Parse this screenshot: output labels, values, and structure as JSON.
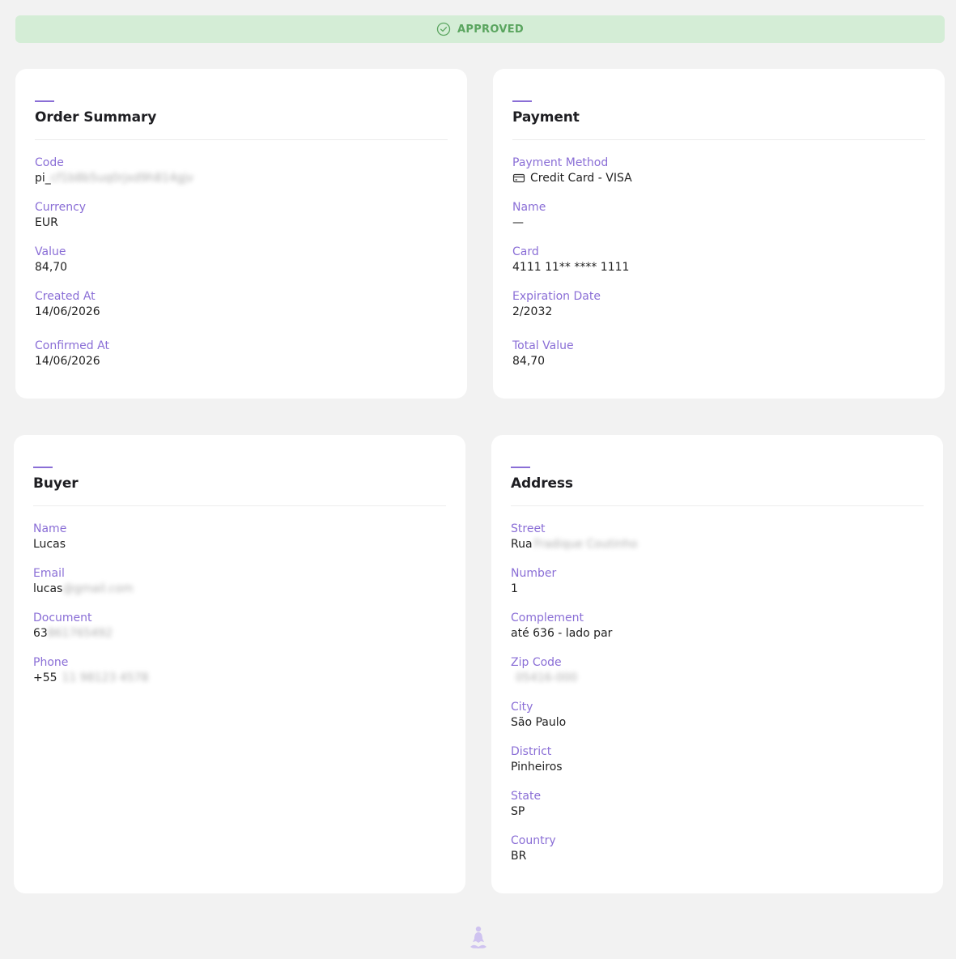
{
  "status": {
    "label": "APPROVED",
    "icon": "check-circle-icon",
    "color": "#5aa55f"
  },
  "order_summary": {
    "title": "Order Summary",
    "fields": [
      {
        "label": "Code",
        "value": "pi_",
        "redacted": "cf1b8b5uq0rjxd9h814gjv"
      },
      {
        "label": "Currency",
        "value": "EUR"
      },
      {
        "label": "Value",
        "value": "84,70"
      },
      {
        "label": "Created At",
        "value": "14/06/2026"
      },
      {
        "label": "Confirmed At",
        "value": "14/06/2026"
      }
    ]
  },
  "payment": {
    "title": "Payment",
    "fields": [
      {
        "label": "Payment Method",
        "value": "Credit Card - VISA",
        "icon": "credit-card-icon"
      },
      {
        "label": "Name",
        "value": "—"
      },
      {
        "label": "Card",
        "value": "4111 11** **** 1111"
      },
      {
        "label": "Expiration Date",
        "value": "2/2032"
      },
      {
        "label": "Total Value",
        "value": "84,70"
      }
    ]
  },
  "buyer": {
    "title": "Buyer",
    "fields": [
      {
        "label": "Name",
        "value": "Lucas"
      },
      {
        "label": "Email",
        "value": "lucas",
        "redacted": "@gmail.com"
      },
      {
        "label": "Document",
        "value": "63",
        "redacted": "861765492"
      },
      {
        "label": "Phone",
        "value": "+55",
        "redacted": "11 98123 4578"
      }
    ]
  },
  "address": {
    "title": "Address",
    "fields": [
      {
        "label": "Street",
        "value": "Rua",
        "redacted": "Fradique Coutinho"
      },
      {
        "label": "Number",
        "value": "1"
      },
      {
        "label": "Complement",
        "value": "até 636 - lado par"
      },
      {
        "label": "Zip Code",
        "value": "",
        "redacted": "05416-000"
      },
      {
        "label": "City",
        "value": "São Paulo"
      },
      {
        "label": "District",
        "value": "Pinheiros"
      },
      {
        "label": "State",
        "value": "SP"
      },
      {
        "label": "Country",
        "value": "BR"
      }
    ]
  },
  "footer": {
    "logo": "meditation-figure-icon"
  },
  "colors": {
    "accent": "#8a6ed6",
    "status_bg": "#d4edd6",
    "page_bg": "#f2f2f2"
  }
}
